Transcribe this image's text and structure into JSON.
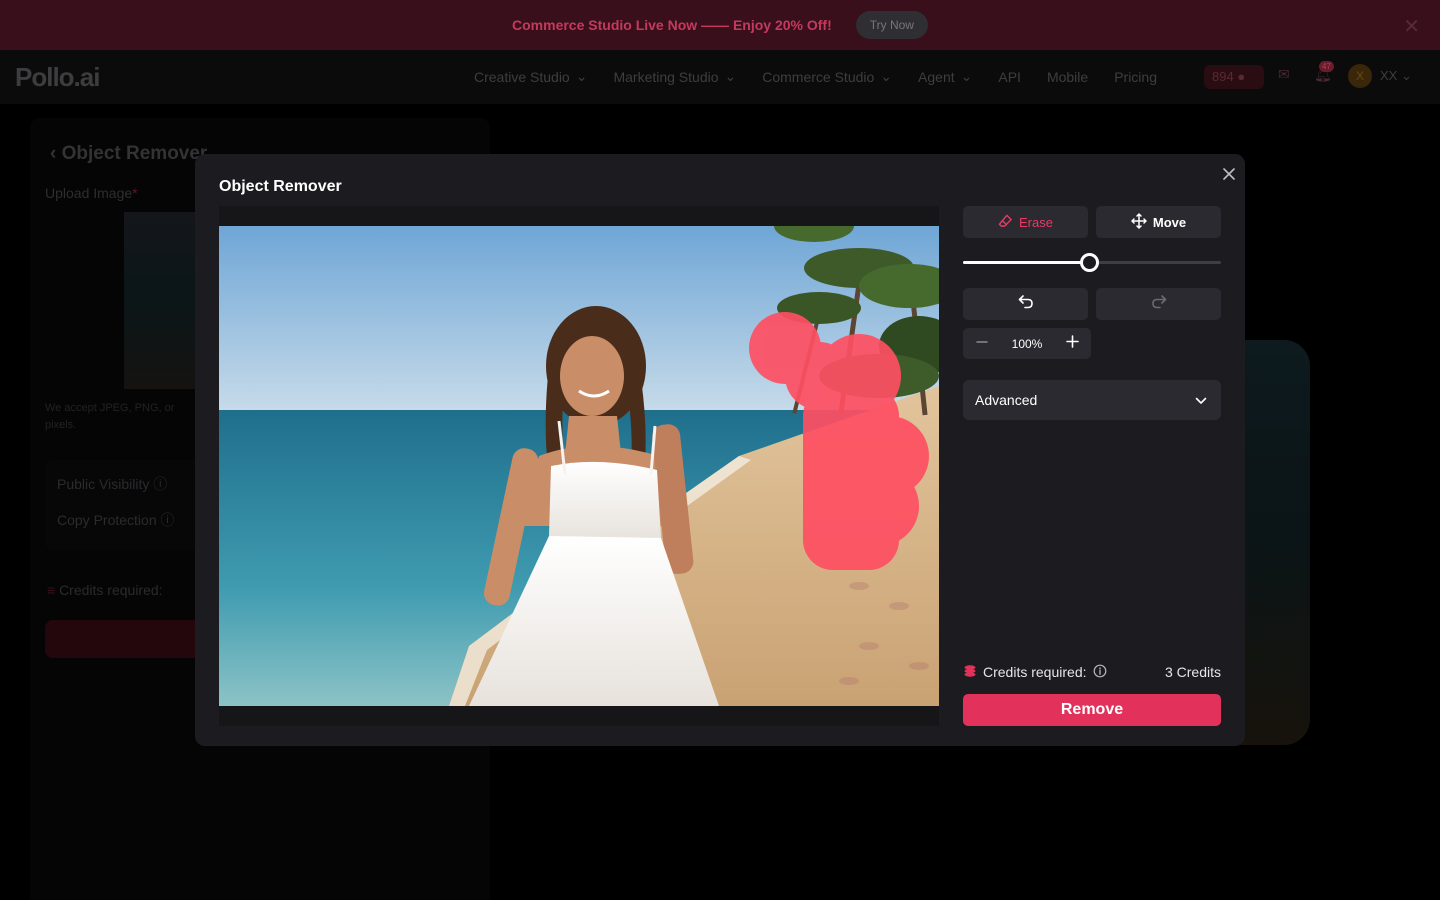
{
  "promo": {
    "text": "Commerce Studio Live Now —— Enjoy 20% Off!",
    "button": "Try Now"
  },
  "nav": {
    "logo": "Pollo.ai",
    "items": [
      "Creative Studio",
      "Marketing Studio",
      "Commerce Studio",
      "Agent",
      "API",
      "Mobile",
      "Pricing"
    ],
    "credits": "894",
    "notification_count": "47",
    "avatar_initial": "X",
    "user": "XX"
  },
  "background_page": {
    "title": "Object Remover",
    "upload_label": "Upload Image",
    "required_mark": "*",
    "accept_text": "We accept JPEG, PNG, or",
    "accept_text_2": "pixels.",
    "public_visibility": "Public Visibility",
    "copy_protection": "Copy Protection",
    "credits_required": "Credits required:"
  },
  "modal": {
    "title": "Object Remover",
    "tools": {
      "erase": "Erase",
      "move": "Move"
    },
    "brush_size": 0.49,
    "zoom": "100%",
    "advanced": "Advanced",
    "credits_label": "Credits required:",
    "credits_amount": "3 Credits",
    "remove_button": "Remove"
  },
  "colors": {
    "accent": "#e2325c",
    "erase_active": "#e83b64",
    "modal_bg": "#1c1c20",
    "control_bg": "#2a2a30",
    "mask": "#ff5064"
  }
}
